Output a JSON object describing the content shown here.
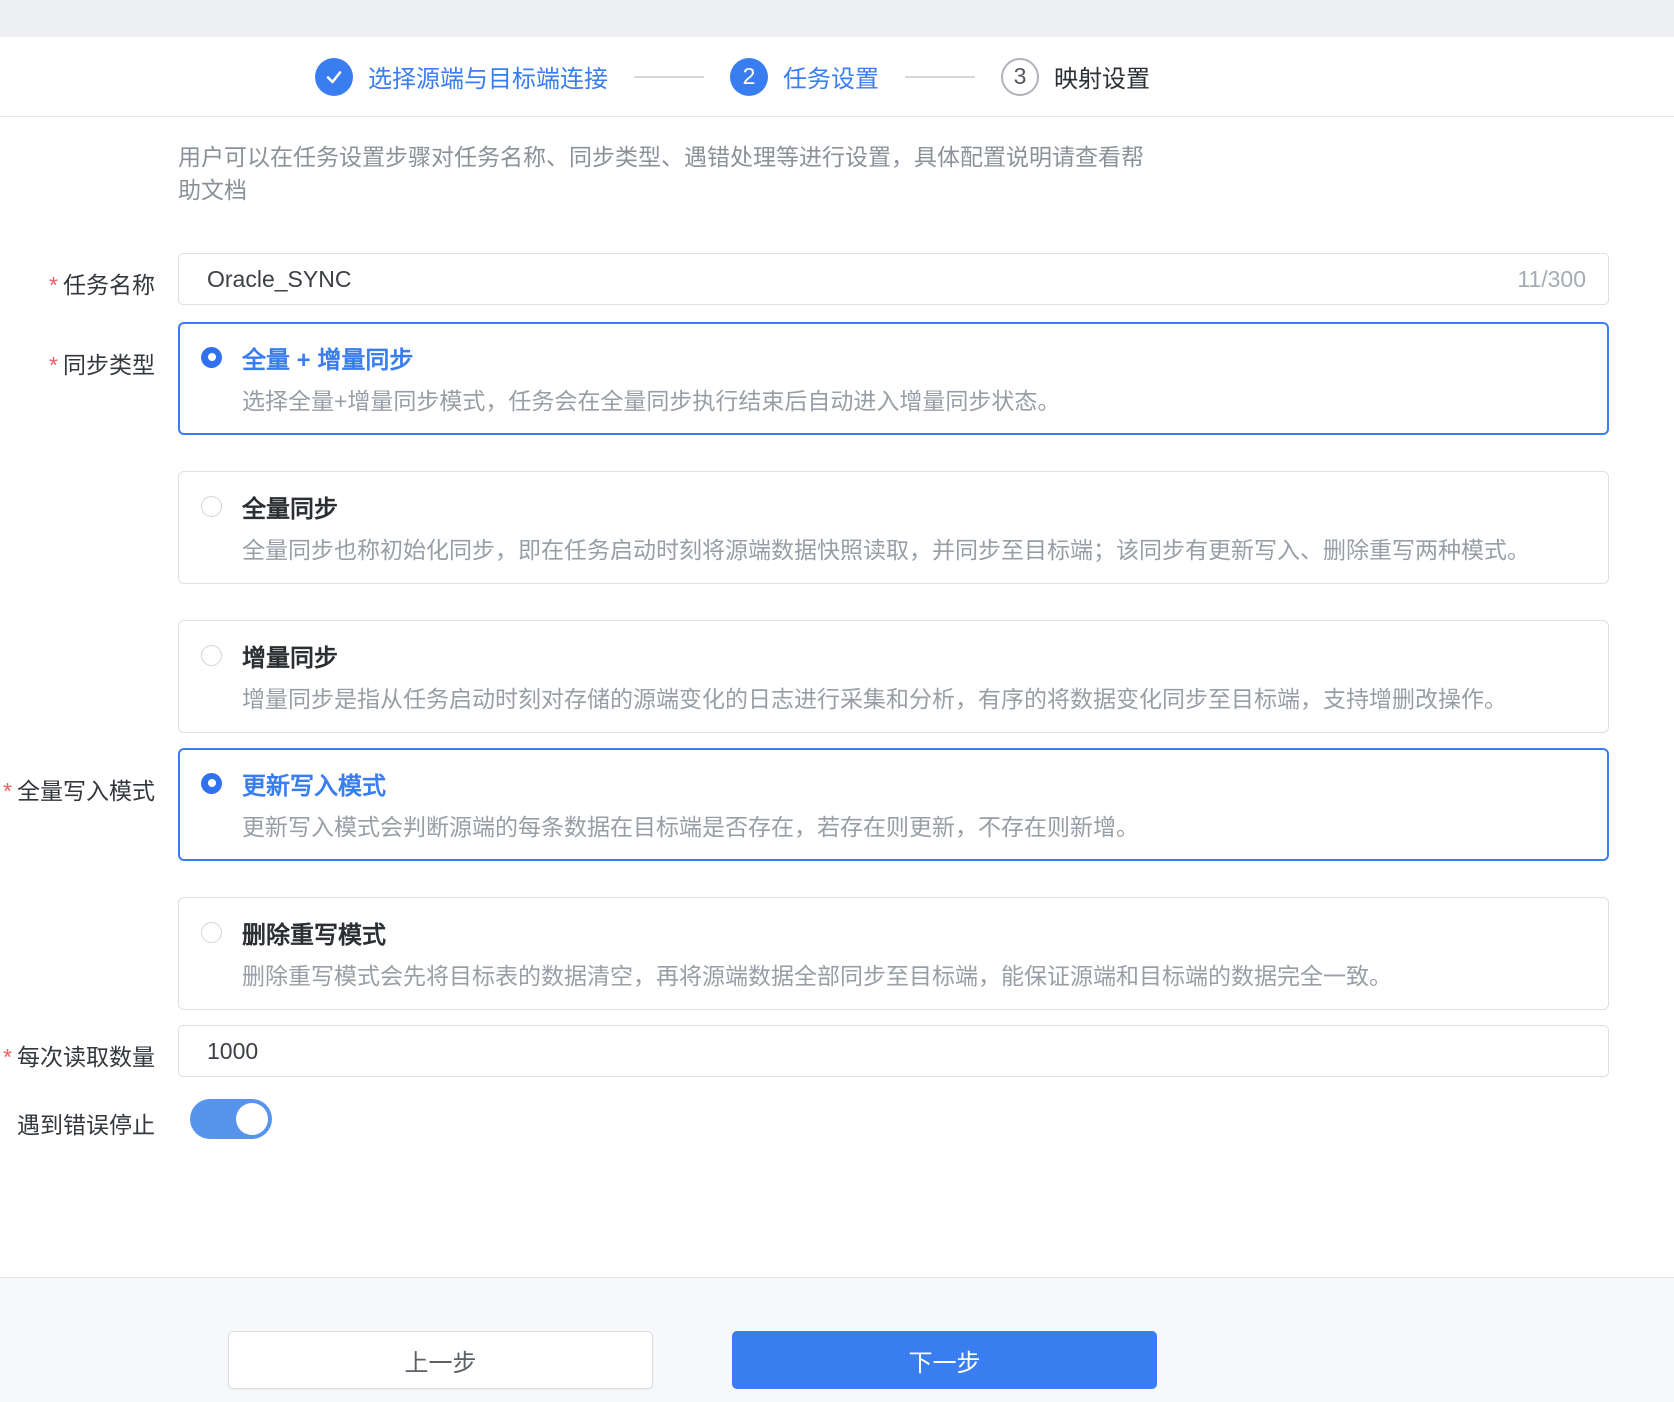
{
  "wizard": {
    "steps": [
      {
        "label": "选择源端与目标端连接",
        "status": "completed"
      },
      {
        "number": "2",
        "label": "任务设置",
        "status": "active"
      },
      {
        "number": "3",
        "label": "映射设置",
        "status": "pending"
      }
    ]
  },
  "description": {
    "line1": "用户可以在任务设置步骤对任务名称、同步类型、遇错处理等进行设置，具体配置说明请查看帮",
    "line2": "助文档"
  },
  "form": {
    "required_mark": "*",
    "task_name": {
      "label": "任务名称",
      "value": "Oracle_SYNC",
      "counter": "11/300"
    },
    "sync_type": {
      "label": "同步类型",
      "options": [
        {
          "title": "全量 + 增量同步",
          "desc": "选择全量+增量同步模式，任务会在全量同步执行结束后自动进入增量同步状态。",
          "selected": true
        },
        {
          "title": "全量同步",
          "desc": "全量同步也称初始化同步，即在任务启动时刻将源端数据快照读取，并同步至目标端；该同步有更新写入、删除重写两种模式。",
          "selected": false
        },
        {
          "title": "增量同步",
          "desc": "增量同步是指从任务启动时刻对存储的源端变化的日志进行采集和分析，有序的将数据变化同步至目标端，支持增删改操作。",
          "selected": false
        }
      ]
    },
    "full_write_mode": {
      "label": "全量写入模式",
      "options": [
        {
          "title": "更新写入模式",
          "desc": "更新写入模式会判断源端的每条数据在目标端是否存在，若存在则更新，不存在则新增。",
          "selected": true
        },
        {
          "title": "删除重写模式",
          "desc": "删除重写模式会先将目标表的数据清空，再将源端数据全部同步至目标端，能保证源端和目标端的数据完全一致。",
          "selected": false
        }
      ]
    },
    "batch_read_count": {
      "label": "每次读取数量",
      "value": "1000"
    },
    "stop_on_error": {
      "label": "遇到错误停止",
      "enabled": true
    }
  },
  "footer": {
    "prev_label": "上一步",
    "next_label": "下一步"
  },
  "colors": {
    "primary_blue": "#3a7df0",
    "toggle_blue": "#5794ee",
    "required_red": "#f05f5f",
    "description_gray": "#8b9199",
    "card_border": "#dcdfe6"
  }
}
